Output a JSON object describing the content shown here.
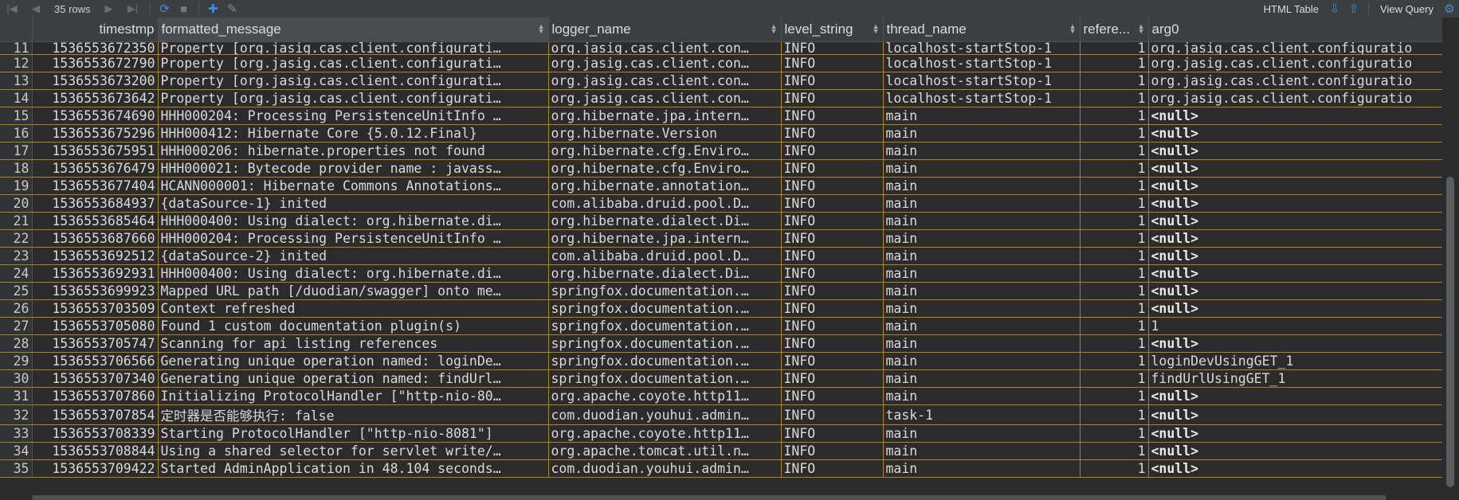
{
  "toolbar": {
    "rows_label": "35 rows",
    "html_table": "HTML Table",
    "view_query": "View Query"
  },
  "columns": [
    "",
    "timestmp",
    "formatted_message",
    "logger_name",
    "level_string",
    "thread_name",
    "refere...",
    "arg0"
  ],
  "rows": [
    [
      "11",
      "1536553672350",
      "Property [org.jasig.cas.client.configurati…",
      "org.jasig.cas.client.con…",
      "INFO",
      "localhost-startStop-1",
      "1",
      "org.jasig.cas.client.configuratio"
    ],
    [
      "12",
      "1536553672790",
      "Property [org.jasig.cas.client.configurati…",
      "org.jasig.cas.client.con…",
      "INFO",
      "localhost-startStop-1",
      "1",
      "org.jasig.cas.client.configuratio"
    ],
    [
      "13",
      "1536553673200",
      "Property [org.jasig.cas.client.configurati…",
      "org.jasig.cas.client.con…",
      "INFO",
      "localhost-startStop-1",
      "1",
      "org.jasig.cas.client.configuratio"
    ],
    [
      "14",
      "1536553673642",
      "Property [org.jasig.cas.client.configurati…",
      "org.jasig.cas.client.con…",
      "INFO",
      "localhost-startStop-1",
      "1",
      "org.jasig.cas.client.configuratio"
    ],
    [
      "15",
      "1536553674690",
      "HHH000204: Processing PersistenceUnitInfo …",
      "org.hibernate.jpa.intern…",
      "INFO",
      "main",
      "1",
      "<null>"
    ],
    [
      "16",
      "1536553675296",
      "HHH000412: Hibernate Core {5.0.12.Final}",
      "org.hibernate.Version",
      "INFO",
      "main",
      "1",
      "<null>"
    ],
    [
      "17",
      "1536553675951",
      "HHH000206: hibernate.properties not found",
      "org.hibernate.cfg.Enviro…",
      "INFO",
      "main",
      "1",
      "<null>"
    ],
    [
      "18",
      "1536553676479",
      "HHH000021: Bytecode provider name : javass…",
      "org.hibernate.cfg.Enviro…",
      "INFO",
      "main",
      "1",
      "<null>"
    ],
    [
      "19",
      "1536553677404",
      "HCANN000001: Hibernate Commons Annotations…",
      "org.hibernate.annotation…",
      "INFO",
      "main",
      "1",
      "<null>"
    ],
    [
      "20",
      "1536553684937",
      "{dataSource-1} inited",
      "com.alibaba.druid.pool.D…",
      "INFO",
      "main",
      "1",
      "<null>"
    ],
    [
      "21",
      "1536553685464",
      "HHH000400: Using dialect: org.hibernate.di…",
      "org.hibernate.dialect.Di…",
      "INFO",
      "main",
      "1",
      "<null>"
    ],
    [
      "22",
      "1536553687660",
      "HHH000204: Processing PersistenceUnitInfo …",
      "org.hibernate.jpa.intern…",
      "INFO",
      "main",
      "1",
      "<null>"
    ],
    [
      "23",
      "1536553692512",
      "{dataSource-2} inited",
      "com.alibaba.druid.pool.D…",
      "INFO",
      "main",
      "1",
      "<null>"
    ],
    [
      "24",
      "1536553692931",
      "HHH000400: Using dialect: org.hibernate.di…",
      "org.hibernate.dialect.Di…",
      "INFO",
      "main",
      "1",
      "<null>"
    ],
    [
      "25",
      "1536553699923",
      "Mapped URL path [/duodian/swagger] onto me…",
      "springfox.documentation.…",
      "INFO",
      "main",
      "1",
      "<null>"
    ],
    [
      "26",
      "1536553703509",
      "Context refreshed",
      "springfox.documentation.…",
      "INFO",
      "main",
      "1",
      "<null>"
    ],
    [
      "27",
      "1536553705080",
      "Found 1 custom documentation plugin(s)",
      "springfox.documentation.…",
      "INFO",
      "main",
      "1",
      "1"
    ],
    [
      "28",
      "1536553705747",
      "Scanning for api listing references",
      "springfox.documentation.…",
      "INFO",
      "main",
      "1",
      "<null>"
    ],
    [
      "29",
      "1536553706566",
      "Generating unique operation named: loginDe…",
      "springfox.documentation.…",
      "INFO",
      "main",
      "1",
      "loginDevUsingGET_1"
    ],
    [
      "30",
      "1536553707340",
      "Generating unique operation named: findUrl…",
      "springfox.documentation.…",
      "INFO",
      "main",
      "1",
      "findUrlUsingGET_1"
    ],
    [
      "31",
      "1536553707860",
      "Initializing ProtocolHandler [\"http-nio-80…",
      "org.apache.coyote.http11…",
      "INFO",
      "main",
      "1",
      "<null>"
    ],
    [
      "32",
      "1536553707854",
      "定时器是否能够执行: false",
      "com.duodian.youhui.admin…",
      "INFO",
      "task-1",
      "1",
      "<null>"
    ],
    [
      "33",
      "1536553708339",
      "Starting ProtocolHandler [\"http-nio-8081\"]",
      "org.apache.coyote.http11…",
      "INFO",
      "main",
      "1",
      "<null>"
    ],
    [
      "34",
      "1536553708844",
      "Using a shared selector for servlet write/…",
      "org.apache.tomcat.util.n…",
      "INFO",
      "main",
      "1",
      "<null>"
    ],
    [
      "35",
      "1536553709422",
      "Started AdminApplication in 48.104 seconds…",
      "com.duodian.youhui.admin…",
      "INFO",
      "main",
      "1",
      "<null>"
    ]
  ]
}
